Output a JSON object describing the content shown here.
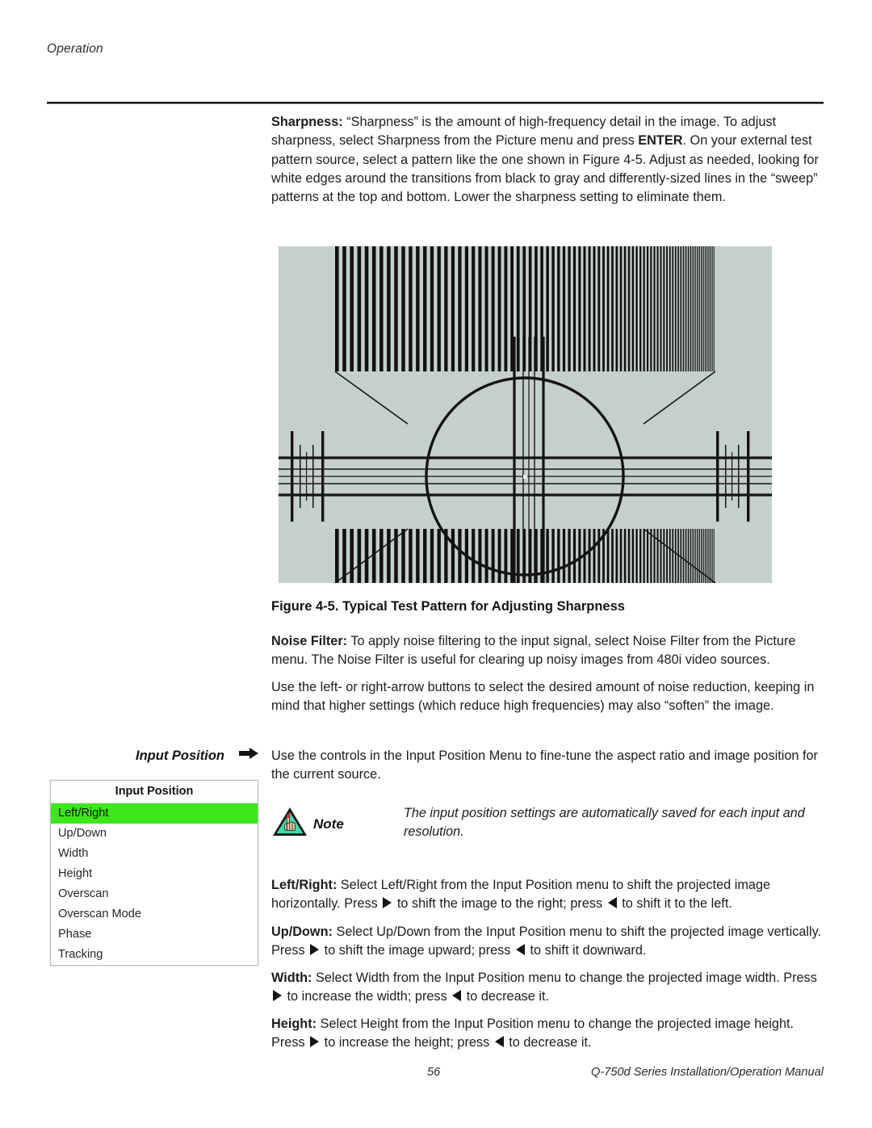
{
  "header": {
    "running_head": "Operation"
  },
  "body": {
    "sharpness_label": "Sharpness:",
    "sharpness_text": " “Sharpness” is the amount of high-frequency detail in the image. To adjust sharpness, select Sharpness from the Picture menu and press ",
    "sharpness_enter": "ENTER",
    "sharpness_text2": ". On your external test pattern source, select a pattern like the one shown in Figure 4-5. Adjust as needed, looking for white edges around the transitions from black to gray and differently-sized lines in the “sweep” patterns at the top and bottom. Lower the sharpness setting to eliminate them.",
    "figure_caption": "Figure 4-5. Typical Test Pattern for Adjusting Sharpness",
    "noise_label": "Noise Filter:",
    "noise_text": " To apply noise filtering to the input signal, select Noise Filter from the Picture menu. The Noise Filter is useful for clearing up noisy images from 480i video sources.",
    "noise_text2": "Use the left- or right-arrow buttons to select the desired amount of noise reduction, keeping in mind that higher settings (which reduce high frequencies) may also “soften” the image.",
    "inputpos_text": "Use the controls in the Input Position Menu to fine-tune the aspect ratio and image position for the current source.",
    "leftright_label": "Left/Right:",
    "leftright_text1": " Select Left/Right from the Input Position menu to shift the projected image horizontally. Press ",
    "leftright_text2": " to shift the image to the right; press ",
    "leftright_text3": " to shift it to the left.",
    "updown_label": "Up/Down:",
    "updown_text1": " Select Up/Down from the Input Position menu to shift the projected image vertically. Press ",
    "updown_text2": " to shift the image upward; press ",
    "updown_text3": " to shift it downward.",
    "width_label": "Width:",
    "width_text1": " Select Width from the Input Position menu to change the projected image width. Press ",
    "width_text2": " to increase the width; press ",
    "width_text3": " to decrease it.",
    "height_label": "Height:",
    "height_text1": " Select Height from the Input Position menu to change the projected image height. Press ",
    "height_text2": " to increase the height; press ",
    "height_text3": " to decrease it."
  },
  "marker": {
    "label": "Input Position",
    "arrow_icon": "arrow-right-icon"
  },
  "osd_menu": {
    "title": "Input Position",
    "selected_index": 0,
    "highlight_color": "#3ee71c",
    "items": [
      "Left/Right",
      "Up/Down",
      "Width",
      "Height",
      "Overscan",
      "Overscan Mode",
      "Phase",
      "Tracking"
    ]
  },
  "note": {
    "icon": "note-warning-triangle-hand-icon",
    "label": "Note",
    "text": "The input position settings are automatically saved for each input and resolution.",
    "triangle_color": "#3ddcae"
  },
  "figure": {
    "name": "sharpness-test-pattern",
    "background_color": "#c5cfcc",
    "description": "Typical test pattern: vertical frequency sweep bars at top and bottom, center circle with crosshairs, and crosshatch burst groups at left, center and right."
  },
  "footer": {
    "page_number": "56",
    "manual_title": "Q-750d Series Installation/Operation Manual"
  }
}
